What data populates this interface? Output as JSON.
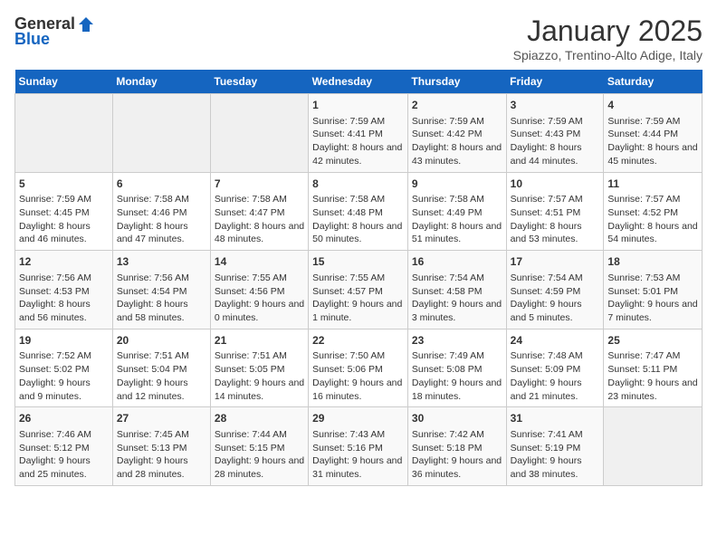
{
  "logo": {
    "general": "General",
    "blue": "Blue"
  },
  "title": "January 2025",
  "location": "Spiazzo, Trentino-Alto Adige, Italy",
  "weekdays": [
    "Sunday",
    "Monday",
    "Tuesday",
    "Wednesday",
    "Thursday",
    "Friday",
    "Saturday"
  ],
  "weeks": [
    [
      {
        "day": "",
        "content": ""
      },
      {
        "day": "",
        "content": ""
      },
      {
        "day": "",
        "content": ""
      },
      {
        "day": "1",
        "content": "Sunrise: 7:59 AM\nSunset: 4:41 PM\nDaylight: 8 hours and 42 minutes."
      },
      {
        "day": "2",
        "content": "Sunrise: 7:59 AM\nSunset: 4:42 PM\nDaylight: 8 hours and 43 minutes."
      },
      {
        "day": "3",
        "content": "Sunrise: 7:59 AM\nSunset: 4:43 PM\nDaylight: 8 hours and 44 minutes."
      },
      {
        "day": "4",
        "content": "Sunrise: 7:59 AM\nSunset: 4:44 PM\nDaylight: 8 hours and 45 minutes."
      }
    ],
    [
      {
        "day": "5",
        "content": "Sunrise: 7:59 AM\nSunset: 4:45 PM\nDaylight: 8 hours and 46 minutes."
      },
      {
        "day": "6",
        "content": "Sunrise: 7:58 AM\nSunset: 4:46 PM\nDaylight: 8 hours and 47 minutes."
      },
      {
        "day": "7",
        "content": "Sunrise: 7:58 AM\nSunset: 4:47 PM\nDaylight: 8 hours and 48 minutes."
      },
      {
        "day": "8",
        "content": "Sunrise: 7:58 AM\nSunset: 4:48 PM\nDaylight: 8 hours and 50 minutes."
      },
      {
        "day": "9",
        "content": "Sunrise: 7:58 AM\nSunset: 4:49 PM\nDaylight: 8 hours and 51 minutes."
      },
      {
        "day": "10",
        "content": "Sunrise: 7:57 AM\nSunset: 4:51 PM\nDaylight: 8 hours and 53 minutes."
      },
      {
        "day": "11",
        "content": "Sunrise: 7:57 AM\nSunset: 4:52 PM\nDaylight: 8 hours and 54 minutes."
      }
    ],
    [
      {
        "day": "12",
        "content": "Sunrise: 7:56 AM\nSunset: 4:53 PM\nDaylight: 8 hours and 56 minutes."
      },
      {
        "day": "13",
        "content": "Sunrise: 7:56 AM\nSunset: 4:54 PM\nDaylight: 8 hours and 58 minutes."
      },
      {
        "day": "14",
        "content": "Sunrise: 7:55 AM\nSunset: 4:56 PM\nDaylight: 9 hours and 0 minutes."
      },
      {
        "day": "15",
        "content": "Sunrise: 7:55 AM\nSunset: 4:57 PM\nDaylight: 9 hours and 1 minute."
      },
      {
        "day": "16",
        "content": "Sunrise: 7:54 AM\nSunset: 4:58 PM\nDaylight: 9 hours and 3 minutes."
      },
      {
        "day": "17",
        "content": "Sunrise: 7:54 AM\nSunset: 4:59 PM\nDaylight: 9 hours and 5 minutes."
      },
      {
        "day": "18",
        "content": "Sunrise: 7:53 AM\nSunset: 5:01 PM\nDaylight: 9 hours and 7 minutes."
      }
    ],
    [
      {
        "day": "19",
        "content": "Sunrise: 7:52 AM\nSunset: 5:02 PM\nDaylight: 9 hours and 9 minutes."
      },
      {
        "day": "20",
        "content": "Sunrise: 7:51 AM\nSunset: 5:04 PM\nDaylight: 9 hours and 12 minutes."
      },
      {
        "day": "21",
        "content": "Sunrise: 7:51 AM\nSunset: 5:05 PM\nDaylight: 9 hours and 14 minutes."
      },
      {
        "day": "22",
        "content": "Sunrise: 7:50 AM\nSunset: 5:06 PM\nDaylight: 9 hours and 16 minutes."
      },
      {
        "day": "23",
        "content": "Sunrise: 7:49 AM\nSunset: 5:08 PM\nDaylight: 9 hours and 18 minutes."
      },
      {
        "day": "24",
        "content": "Sunrise: 7:48 AM\nSunset: 5:09 PM\nDaylight: 9 hours and 21 minutes."
      },
      {
        "day": "25",
        "content": "Sunrise: 7:47 AM\nSunset: 5:11 PM\nDaylight: 9 hours and 23 minutes."
      }
    ],
    [
      {
        "day": "26",
        "content": "Sunrise: 7:46 AM\nSunset: 5:12 PM\nDaylight: 9 hours and 25 minutes."
      },
      {
        "day": "27",
        "content": "Sunrise: 7:45 AM\nSunset: 5:13 PM\nDaylight: 9 hours and 28 minutes."
      },
      {
        "day": "28",
        "content": "Sunrise: 7:44 AM\nSunset: 5:15 PM\nDaylight: 9 hours and 28 minutes."
      },
      {
        "day": "29",
        "content": "Sunrise: 7:43 AM\nSunset: 5:16 PM\nDaylight: 9 hours and 31 minutes."
      },
      {
        "day": "30",
        "content": "Sunrise: 7:42 AM\nSunset: 5:18 PM\nDaylight: 9 hours and 36 minutes."
      },
      {
        "day": "31",
        "content": "Sunrise: 7:41 AM\nSunset: 5:19 PM\nDaylight: 9 hours and 38 minutes."
      },
      {
        "day": "",
        "content": ""
      }
    ]
  ]
}
